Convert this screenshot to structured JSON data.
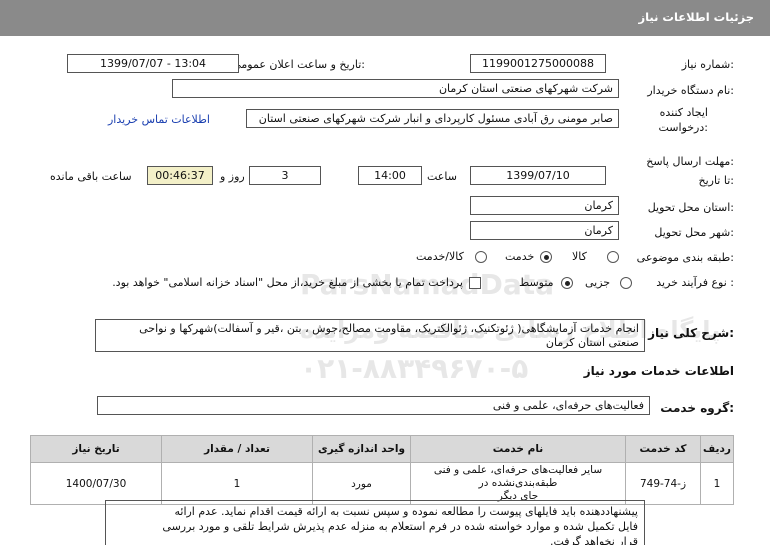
{
  "header": {
    "title": "جزئیات اطلاعات نیاز"
  },
  "fields": {
    "need_number_label": "شماره نیاز:",
    "need_number": "1199001275000088",
    "announce_label": "تاریخ و ساعت اعلان عمومی:",
    "announce_value": "1399/07/07 - 13:04",
    "buyer_label": "نام دستگاه خریدار:",
    "buyer_value": "شرکت شهرکهای صنعتی استان کرمان",
    "creator_label_1": "ایجاد کننده",
    "creator_label_2": "درخواست:",
    "creator_value": "صابر مومنی رق آبادی مسئول کارپردای و انبار شرکت شهرکهای صنعتی استان",
    "contact_link": "اطلاعات تماس خریدار",
    "deadline_label_1": "مهلت ارسال پاسخ:",
    "deadline_label_2": "تا تاریخ:",
    "deadline_date": "1399/07/10",
    "time_label": "ساعت",
    "deadline_time": "14:00",
    "days_value": "3",
    "days_label": "روز و",
    "remaining_time": "00:46:37",
    "remaining_label": "ساعت باقی مانده",
    "province_label": "استان محل تحویل:",
    "province_value": "کرمان",
    "city_label": "شهر محل تحویل:",
    "city_value": "کرمان",
    "category_label": "طبقه بندی موضوعی:",
    "category_options": [
      "کالا",
      "خدمت",
      "کالا/خدمت"
    ],
    "category_selected": "خدمت",
    "process_label": "نوع فرآیند خرید :",
    "process_options": [
      "جزیی",
      "متوسط"
    ],
    "process_selected": "متوسط",
    "payment_note": "پرداخت تمام یا بخشی از مبلغ خرید،از محل \"اسناد خزانه اسلامی\" خواهد بود.",
    "summary_label": "شرح کلی نیاز:",
    "summary_line_1": "انجام خدمات آزمایشگاهی( ژئوتکنیک، ژئوالکتریک، مقاومت مصالح،جوش ، بتن ،قیر و آسفالت)شهرکها و نواحی",
    "summary_line_2": "صنعتی استان کرمان"
  },
  "services": {
    "section_title": "اطلاعات خدمات مورد نیاز",
    "group_label": "گروه خدمت:",
    "group_value": "فعالیت‌های حرفه‌ای، علمی و فنی",
    "columns": [
      "ردیف",
      "کد خدمت",
      "نام خدمت",
      "واحد اندازه گیری",
      "تعداد / مقدار",
      "تاریخ نیاز"
    ],
    "rows": [
      {
        "index": "1",
        "code": "ز-74-749",
        "name_line_1": "سایر فعالیت‌های حرفه‌ای، علمی و فنی طبقه‌بندی‌نشده در",
        "name_line_2": "جای دیگر",
        "unit": "مورد",
        "qty": "1",
        "date": "1400/07/30"
      }
    ]
  },
  "notes": {
    "line_1": "پیشنهاددهنده باید فایلهای پیوست را مطالعه نموده و سپس نسبت به ارائه قیمت اقدام نماید. عدم ارائه",
    "line_2": "فایل تکمیل شده و موارد خواسته شده در فرم استعلام به منزله عدم پذیرش شرایط تلقی و مورد بررسی",
    "line_3": "قرار نخواهد گرفت."
  },
  "watermark": {
    "line_1": "ParsNamadData",
    "line_2": "پایگاه اطلاع رسانی مناقصه ومزایده",
    "line_3": "۰۲۱-۸۸۳۴۹۶۷۰-۵"
  }
}
